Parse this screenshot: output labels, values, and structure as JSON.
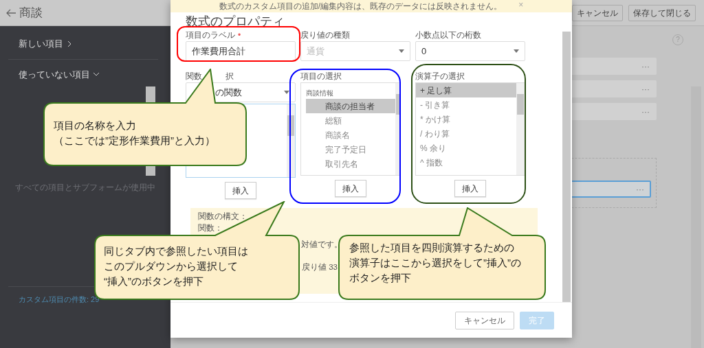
{
  "app": {
    "title": "商談",
    "buttons": [
      {
        "label": "キャンセル"
      },
      {
        "label": "保存して閉じる"
      }
    ]
  },
  "sidebar": {
    "links": [
      {
        "label": "新しい項目",
        "expanded": false
      },
      {
        "label": "使っていない項目",
        "expanded": true
      }
    ],
    "empty_note": "すべての項目とサブフォームが使用中",
    "count": "カスタム項目の件数: 29"
  },
  "canvas": {
    "help": "?",
    "cards": [
      {
        "menu": "···",
        "selected": false
      },
      {
        "menu": "···",
        "selected": false
      },
      {
        "menu": "···",
        "selected": false
      }
    ],
    "section": {
      "cards": [
        {
          "menu": "···",
          "selected": true
        }
      ]
    }
  },
  "modal": {
    "notice": "数式のカスタム項目の追加/編集内容は、既存のデータには反映されません。",
    "close": "×",
    "title": "数式のプロパティ",
    "fields": [
      {
        "label": "項目のラベル",
        "required_mark": "•",
        "value": "作業費用合計",
        "disabled": false,
        "kind": "input"
      },
      {
        "label": "戻り値の種類",
        "value": "通貨",
        "disabled": true,
        "kind": "select"
      },
      {
        "label": "小数点以下の桁数",
        "value": "0",
        "disabled": false,
        "kind": "select"
      }
    ],
    "function_select": {
      "label_parts": [
        "関数",
        "択"
      ],
      "value": "の関数",
      "insert": "挿入"
    },
    "field_select": {
      "label": "項目の選択",
      "group": "商談情報",
      "items": [
        {
          "label": "商談の担当者",
          "selected": true
        },
        {
          "label": "総額",
          "selected": false
        },
        {
          "label": "商談名",
          "selected": false
        },
        {
          "label": "完了予定日",
          "selected": false
        },
        {
          "label": "取引先名",
          "selected": false
        }
      ],
      "insert": "挿入"
    },
    "operator_select": {
      "label": "演算子の選択",
      "items": [
        {
          "label": "+ 足し算",
          "selected": true
        },
        {
          "label": "- 引き算",
          "selected": false
        },
        {
          "label": "* かけ算",
          "selected": false
        },
        {
          "label": "/ わり算",
          "selected": false
        },
        {
          "label": "% 余り",
          "selected": false
        },
        {
          "label": "^ 指数",
          "selected": false
        }
      ],
      "insert": "挿入"
    },
    "syntax": {
      "title": "関数の構文：",
      "texts": [
        "関数：",
        "対値です。",
        "戻り値 33"
      ]
    },
    "buttons": [
      {
        "label": "キャンセル",
        "disabled": false
      },
      {
        "label": "完了",
        "disabled": true
      }
    ]
  },
  "annotations": [
    {
      "kind": "frame",
      "color": "#ff0000"
    },
    {
      "kind": "frame",
      "color": "#0000ff"
    },
    {
      "kind": "frame",
      "color": "#2d5016"
    }
  ],
  "callouts": [
    {
      "lines": [
        "項目の名称を入力",
        "（ここでは”定形作業費用”と入力）"
      ]
    },
    {
      "lines": [
        "同じタブ内で参照したい項目は",
        "このプルダウンから選択して",
        "“挿入”のボタンを押下"
      ]
    },
    {
      "lines": [
        "参照した項目を四則演算するための",
        "演算子はここから選択をして”挿入”の",
        "ボタンを押下"
      ]
    }
  ]
}
